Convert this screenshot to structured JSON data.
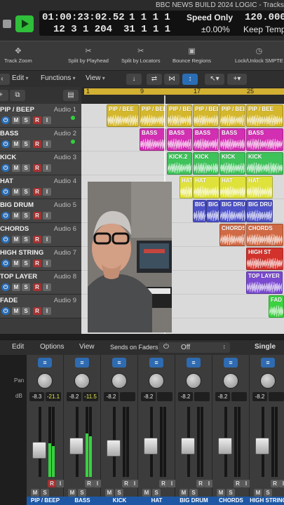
{
  "window": {
    "title": "BBC NEWS BUILD 2024 LOGIC - Tracks"
  },
  "transport": {
    "timecode": "01:00:23:02.52",
    "position_top": "1  1  1  1",
    "tempo": "120.0000",
    "mode": "Speed Only",
    "bars_beats": "12  3  1  204",
    "position_bottom": "31  1  1  1",
    "percent": "±0.00%",
    "keep_tempo": "Keep Tempo"
  },
  "controls": [
    {
      "label": "Track Zoom",
      "icon": "track-zoom-icon"
    },
    {
      "label": "Split by Playhead",
      "icon": "scissors-icon"
    },
    {
      "label": "Split by Locators",
      "icon": "scissors-locators-icon"
    },
    {
      "label": "Bounce Regions",
      "icon": "bounce-icon"
    },
    {
      "label": "Lock/Unlock SMPTE",
      "icon": "clock-icon"
    }
  ],
  "toolbar": {
    "edit": "Edit",
    "functions": "Functions",
    "view": "View"
  },
  "ruler": {
    "bars": [
      "1",
      "9",
      "17",
      "25"
    ]
  },
  "tracks": [
    {
      "name": "PIP / BEEP",
      "number": "Audio 1",
      "led": true
    },
    {
      "name": "BASS",
      "number": "Audio 2",
      "led": true
    },
    {
      "name": "KICK",
      "number": "Audio 3",
      "led": false
    },
    {
      "name": "HAT",
      "number": "Audio 4",
      "led": false
    },
    {
      "name": "BIG DRUM",
      "number": "Audio 5",
      "led": false
    },
    {
      "name": "CHORDS",
      "number": "Audio 6",
      "led": false
    },
    {
      "name": "HIGH STRING",
      "number": "Audio 7",
      "led": false
    },
    {
      "name": "TOP LAYER",
      "number": "Audio 8",
      "led": false
    },
    {
      "name": "FADE",
      "number": "Audio 9",
      "led": false
    }
  ],
  "track_buttons": {
    "m": "M",
    "s": "S",
    "r": "R",
    "i": "I"
  },
  "regions": {
    "pip": [
      "PIP / BEE",
      "PIP / BEE",
      "PIP / BEE",
      "PIP / BEE",
      "PIP / BEE",
      "PIP / BEE"
    ],
    "bass": [
      "BASS",
      "BASS",
      "BASS",
      "BASS",
      "BASS"
    ],
    "kick": [
      "KICK.2",
      "KICK",
      "KICK",
      "KICK"
    ],
    "hat": [
      "HAT",
      "HAT",
      "HAT",
      "HAT"
    ],
    "bigdrum": [
      "BIG",
      "BIG DRU",
      "BIG DRU",
      "BIG DRU"
    ],
    "chords": [
      "CHORDS",
      "CHORDS"
    ],
    "highst": [
      "HIGH ST"
    ],
    "toplayer": [
      "TOP LAYER"
    ],
    "fade": [
      "FAD"
    ]
  },
  "colors": {
    "pip": "#d4b72c",
    "bass": "#d22fb2",
    "kick": "#3ec25a",
    "hat": "#e0e23c",
    "bigdrum": "#4d52c8",
    "chords": "#d06a45",
    "highst": "#d2322c",
    "toplayer": "#7a4ad0",
    "fade": "#3bd23f"
  },
  "mixer_bar": {
    "edit": "Edit",
    "options": "Options",
    "view": "View",
    "sends_label": "Sends on Faders:",
    "sends_value": "Off",
    "mode": "Single",
    "pan": "Pan",
    "db": "dB"
  },
  "strips": [
    {
      "name": "PIP / BEEP",
      "vol": "-8.3",
      "peak": "-21.1",
      "level": 0.48
    },
    {
      "name": "BASS",
      "vol": "-8.2",
      "peak": "-11.5",
      "level": 0.62
    },
    {
      "name": "KICK",
      "vol": "-8.2",
      "peak": "",
      "level": 0
    },
    {
      "name": "HAT",
      "vol": "-8.2",
      "peak": "",
      "level": 0
    },
    {
      "name": "BIG DRUM",
      "vol": "-8.2",
      "peak": "",
      "level": 0
    },
    {
      "name": "CHORDS",
      "vol": "-8.2",
      "peak": "",
      "level": 0
    },
    {
      "name": "HIGH STRING",
      "vol": "-8.2",
      "peak": "",
      "level": 0
    }
  ],
  "scale": [
    "6",
    "3",
    "0",
    "3",
    "6",
    "10",
    "15",
    "20",
    "30",
    "40",
    "60"
  ]
}
